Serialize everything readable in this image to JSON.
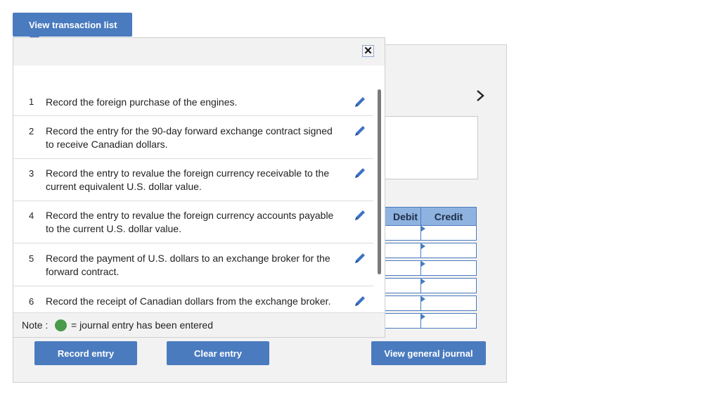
{
  "top_button": {
    "label": "View transaction list"
  },
  "popup": {
    "close_symbol": "✕",
    "items": [
      {
        "num": "1",
        "text": "Record the foreign purchase of the engines."
      },
      {
        "num": "2",
        "text": "Record the entry for the 90-day forward exchange contract signed to receive Canadian dollars."
      },
      {
        "num": "3",
        "text": "Record the entry to revalue the foreign currency receivable to the current equivalent U.S. dollar value."
      },
      {
        "num": "4",
        "text": "Record the entry to revalue the foreign currency accounts payable to the current U.S. dollar value."
      },
      {
        "num": "5",
        "text": "Record the payment of U.S. dollars to an exchange broker for the forward contract."
      },
      {
        "num": "6",
        "text": "Record the receipt of Canadian dollars from the exchange broker."
      }
    ],
    "note": {
      "label": "Note :",
      "text": "= journal entry has been entered"
    }
  },
  "journal": {
    "debit_header": "Debit",
    "credit_header": "Credit",
    "next_symbol": "›"
  },
  "actions": {
    "record": "Record entry",
    "clear": "Clear entry",
    "view_general_journal": "View general journal"
  },
  "colors": {
    "accent": "#4a7bbf",
    "table_header": "#8fb3e0",
    "entered_dot": "#4a9a4a"
  }
}
